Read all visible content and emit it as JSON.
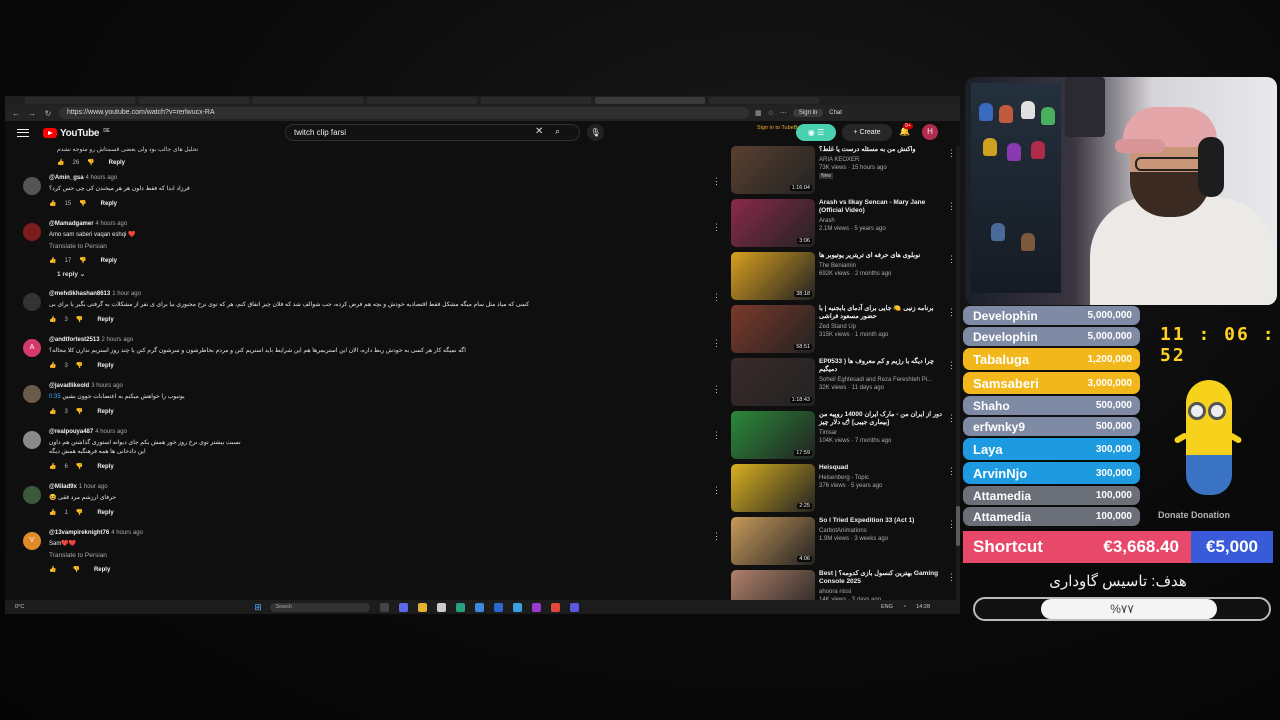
{
  "browser": {
    "url": "https://www.youtube.com/watch?v=rerlwucx-RA",
    "signin": "Sign in",
    "chat": "Chat"
  },
  "youtube": {
    "logo": "YouTube",
    "logo_country": "DE",
    "search_value": "twitch clip farsi",
    "tubebuddy_link": "Sign in to TubeBuddy",
    "create_label": "Create",
    "notif_count": "9+",
    "avatar_letter": "H"
  },
  "comments": {
    "top_text": "تحلیل های جالب بود ولی بعضی قسمتاش رو متوجه نشدم",
    "top_likes": "26",
    "reply_label": "Reply",
    "items": [
      {
        "user": "@Amin_gsa",
        "time": "4 hours ago",
        "text": "فرزاد ابدا که فقط دلون هر هر میخندن کی چی حس کرد؟",
        "likes": "15",
        "color": "#555"
      },
      {
        "user": "@Mamadgamer",
        "time": "4 hours ago",
        "text": "Amo sam saberi vaqan eshqi ❤️",
        "translate": "Translate to Persian",
        "likes": "17",
        "color": "#7a1c1c",
        "replies": "1 reply"
      },
      {
        "user": "@mehdikhashan8613",
        "time": "1 hour ago",
        "text": "کسی که میاد مثل سام میگه مشکل فقط اقتصادیه خودش و بچه هم فرض کرده، جب شوالف شد که فلان چیز اتفاق کنم، هر که توی نرخ مجبوری بیا برای ی نفر از مشکلات یه گرفتی بگیر یا برای بی",
        "likes": "3",
        "color": "#333"
      },
      {
        "user": "@andtfortest2513",
        "time": "2 hours ago",
        "text": "اگه نمیگه کار هر کسی به خودش ربط داره، الان این استریمرها هم این شرایط باید استریم کنن و مردم بخاطرشون و سرشون گرم کنن یا چند روز استریم ندارن کلا محاله؟",
        "likes": "3",
        "color": "#d33a6a",
        "letter": "A"
      },
      {
        "user": "@javadlikeold",
        "time": "3 hours ago",
        "text": "یوتیوب را خواهش میکنم به اعتصابات جوون بشین",
        "link": "0:35",
        "likes": "3",
        "color": "#6a5a4a"
      },
      {
        "user": "@realpouya487",
        "time": "4 hours ago",
        "text": "نسبت بیشتر توی نرخ روز خور همش یکم جای دیوانه استوری گذاشتن هم داون",
        "text2": "این دادخانی ها همه فرهنگیه همش دیگه",
        "likes": "6",
        "color": "#8a8a8a"
      },
      {
        "user": "@Milad9x",
        "time": "1 hour ago",
        "text": "😆 حرفای ارزشم مرد فقی",
        "likes": "1",
        "color": "#3a5a3a"
      },
      {
        "user": "@13vampireknight76",
        "time": "4 hours ago",
        "text": "Sam❤️❤️",
        "translate": "Translate to Persian",
        "likes": "",
        "color": "#e08a2a",
        "letter": "V"
      }
    ]
  },
  "sidebar": {
    "videos": [
      {
        "title": "واکنش من به مسئله درست یا غلط؟",
        "channel": "ARIA KEOXER",
        "stats": "73K views · 15 hours ago",
        "badge": "New",
        "dur": "1:16:04",
        "thumb": "#5a4030"
      },
      {
        "title": "Arash vs Ilkay Sencan - Mary Jane (Official Video)",
        "channel": "Arash",
        "stats": "2.1M views · 5 years ago",
        "dur": "3:06",
        "thumb": "#8a2a4a"
      },
      {
        "title": "نوبلوی های حرفه ای تریتریر یوتیوبر ها",
        "channel": "The Beniamin",
        "stats": "692K views · 2 months ago",
        "dur": "38:18",
        "thumb": "#d8a020"
      },
      {
        "title": "برنامه زنیی 🍋 جایی برای آدمای بابجنبه | با حضور مسعود فراشی",
        "channel": "Zed Stand Up",
        "stats": "315K views · 1 month ago",
        "dur": "58:51",
        "thumb": "#7a3a2a"
      },
      {
        "title": "EP0533 ) چرا دیگه با رژیم و کم معروف ها دمیگیم",
        "channel": "Soheil Eghtesadi and Reza Fereshteh Pi...",
        "stats": "32K views · 11 days ago",
        "dur": "1:18:43",
        "thumb": "#3a2a2a"
      },
      {
        "title": "دور از ایران من - مارک ایران 14000 روپیه من [بیماری جیبی] 🌶 دلار چیز",
        "channel": "Timsar",
        "stats": "104K views · 7 months ago",
        "dur": "17:59",
        "thumb": "#2a8a3a"
      },
      {
        "title": "Heisquad",
        "channel": "Heisenberg - Topic",
        "stats": "376 views · 5 years ago",
        "dur": "2:25",
        "thumb": "#d8b020"
      },
      {
        "title": "So I Tried Expedition 33 (Act 1)",
        "channel": "CarbotAnimations",
        "stats": "1.9M views · 3 weeks ago",
        "dur": "4:06",
        "thumb": "#c89a5a"
      },
      {
        "title": "Best | بهترین کنسول بازی کدومه؟ Gaming Console 2025",
        "channel": "ahoora nissi",
        "stats": "14K views · 3 days ago",
        "dur": "",
        "thumb": "#b0806a"
      }
    ]
  },
  "taskbar": {
    "weather": "0°C",
    "search": "Search",
    "lang": "ENG",
    "time": "14:28"
  },
  "overlay": {
    "clock": "11 : 06 : 52",
    "donors": [
      {
        "name": "Develophin",
        "amount": "5,000,000",
        "color": "#7f8ba4"
      },
      {
        "name": "Develophin",
        "amount": "5,000,000",
        "color": "#7f8ba4"
      },
      {
        "name": "Tabaluga",
        "amount": "1,200,000",
        "color": "#f2b71a",
        "big": true
      },
      {
        "name": "Samsaberi",
        "amount": "3,000,000",
        "color": "#f2b71a",
        "big": true
      },
      {
        "name": "Shaho",
        "amount": "500,000",
        "color": "#7f8ba4"
      },
      {
        "name": "erfwnky9",
        "amount": "500,000",
        "color": "#7f8ba4"
      },
      {
        "name": "Laya",
        "amount": "300,000",
        "color": "#1e9be0",
        "big": true
      },
      {
        "name": "ArvinNjo",
        "amount": "300,000",
        "color": "#1e9be0",
        "big": true
      },
      {
        "name": "Attamedia",
        "amount": "100,000",
        "color": "#6a6f78"
      },
      {
        "name": "Attamedia",
        "amount": "100,000",
        "color": "#6a6f78"
      }
    ],
    "bottom_label": "Donate Donation",
    "shortcut_label": "Shortcut",
    "shortcut_amount": "€3,668.40",
    "goal_amount": "€5,000",
    "goal_title": "هدف: تاسیس گاوداری",
    "goal_progress_label": "%۷۷",
    "goal_progress": 0.77
  }
}
